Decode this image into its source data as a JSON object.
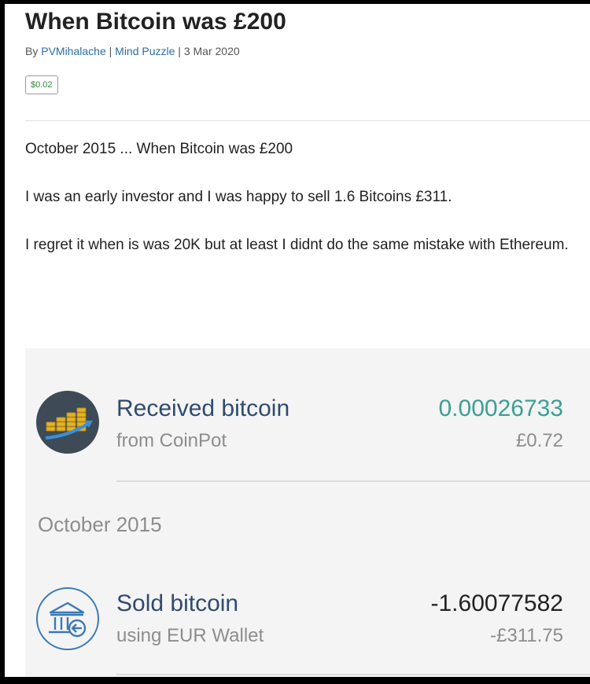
{
  "article": {
    "title": "When Bitcoin was £200",
    "by_prefix": "By ",
    "author": "PVMihalache",
    "separator1": " | ",
    "community": "Mind Puzzle",
    "separator2": " | ",
    "date": "3 Mar 2020",
    "payout": "$0.02",
    "paragraphs": [
      "October 2015 ... When Bitcoin was £200",
      "I was an early investor and I was happy to sell 1.6 Bitcoins £311.",
      "I regret it when is was 20K but at least I didnt do the same mistake with Ethereum."
    ]
  },
  "screenshot": {
    "transactions": [
      {
        "title": "Received bitcoin",
        "subtitle": "from CoinPot",
        "amount": "0.00026733",
        "fiat": "£0.72",
        "amount_color": "#3aa093",
        "icon": "coins-chart-icon"
      },
      {
        "title": "Sold bitcoin",
        "subtitle": "using EUR Wallet",
        "amount": "-1.60077582",
        "fiat": "-£311.75",
        "amount_color": "#222222",
        "icon": "bank-icon"
      }
    ],
    "month_header": "October 2015"
  },
  "colors": {
    "link": "#2d6da3",
    "payout": "#2e8b3a",
    "tx_title": "#2f4b6e"
  }
}
